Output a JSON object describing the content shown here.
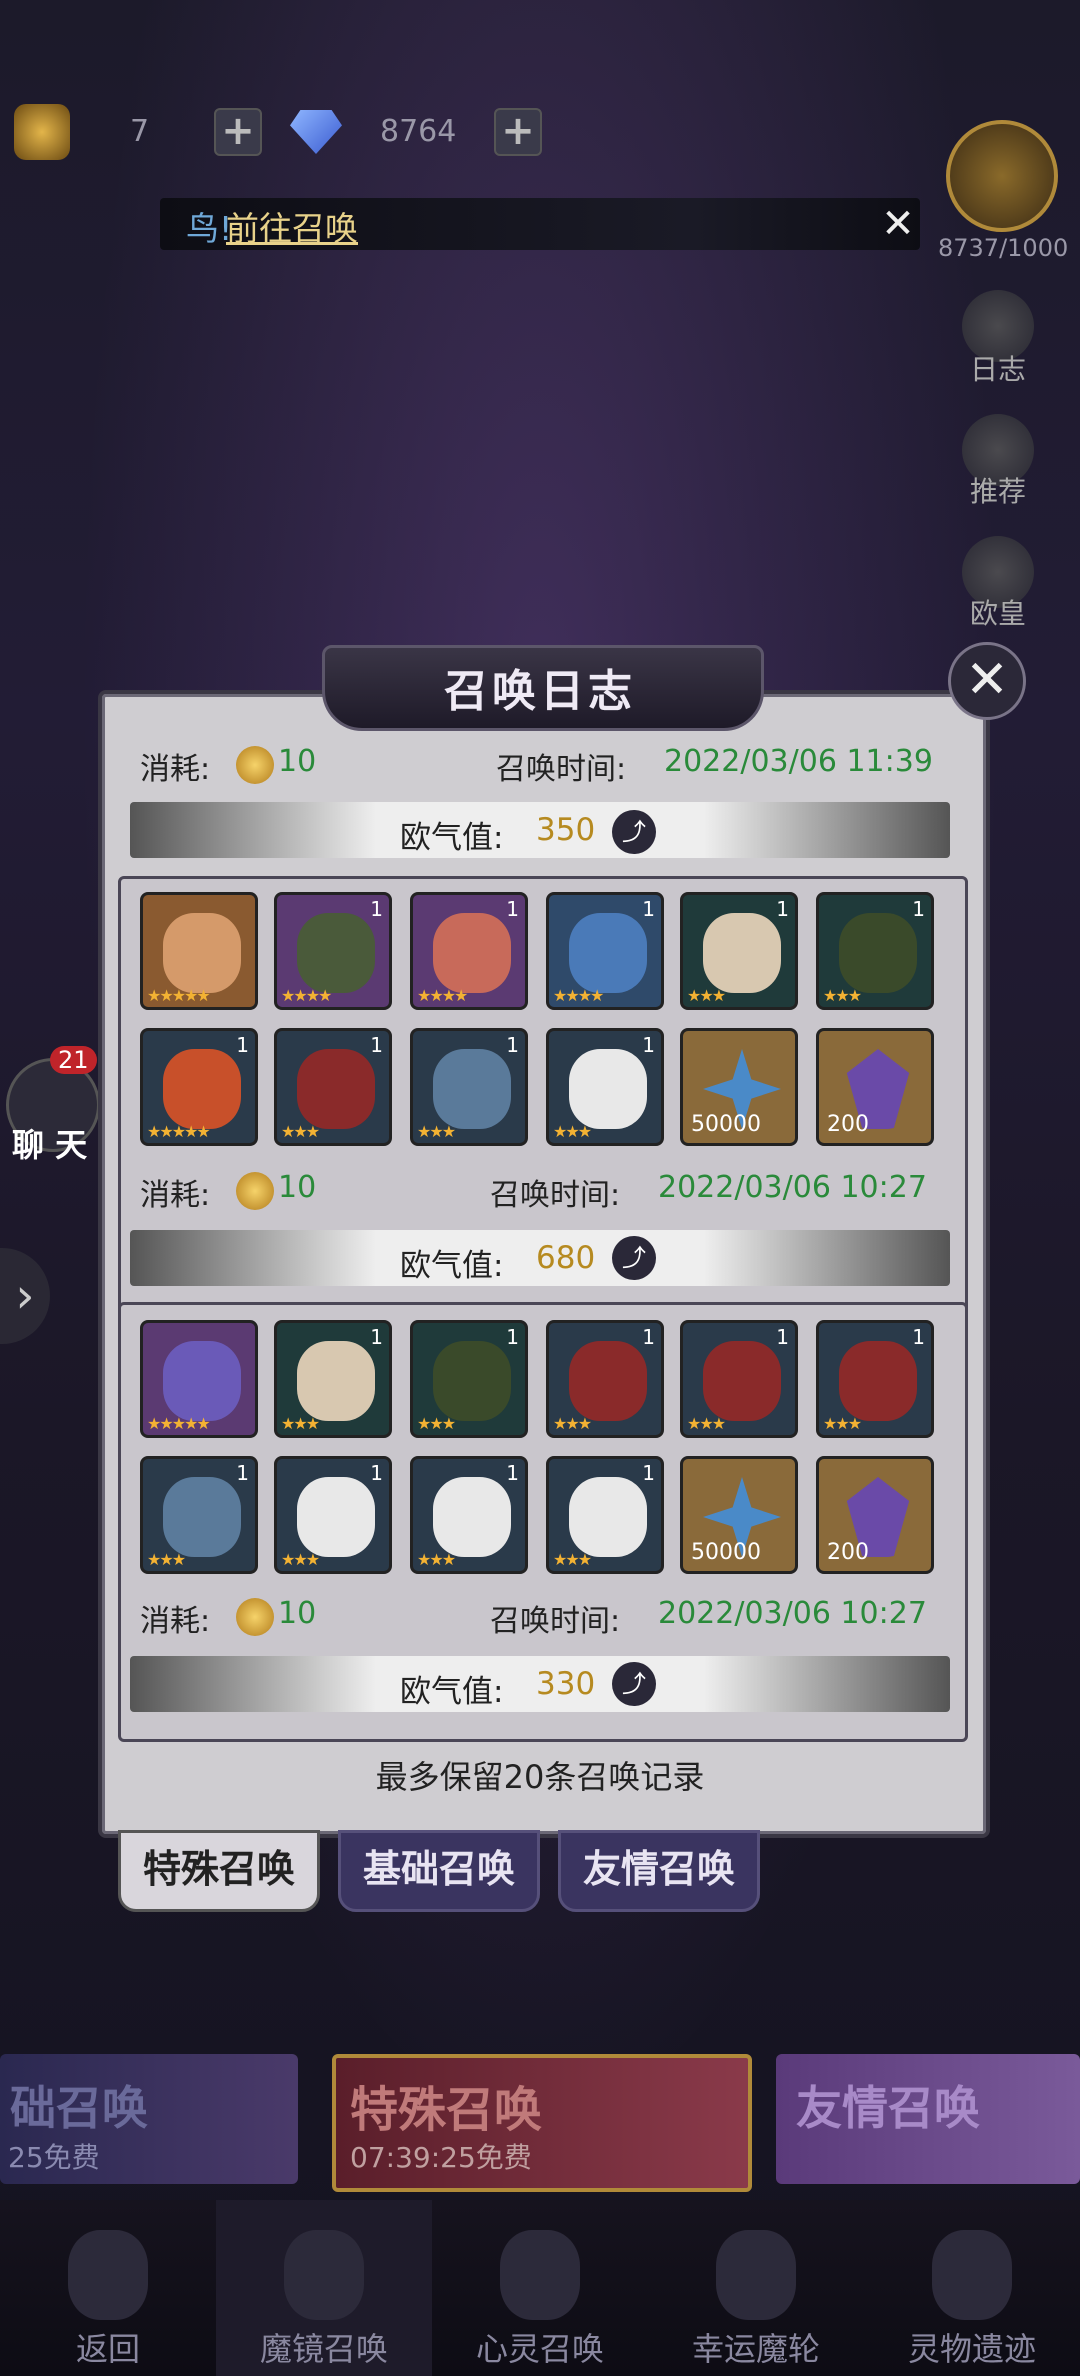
{
  "topbar": {
    "tickets": "7",
    "gems": "8764",
    "avatar_progress": "8737/1000"
  },
  "banner": {
    "prefix": "鸟!",
    "link_text": "前往召唤"
  },
  "side_buttons": [
    "日志",
    "推荐",
    "欧皇"
  ],
  "chat": {
    "badge": "21",
    "label": "聊 天"
  },
  "dialog": {
    "title": "召唤日志",
    "cost_label": "消耗:",
    "time_label": "召唤时间:",
    "lucky_label": "欧气值:",
    "footer_note": "最多保留20条召唤记录",
    "records": [
      {
        "cost": "10",
        "time": "2022/03/06 11:39",
        "lucky": "350"
      },
      {
        "cost": "10",
        "time": "2022/03/06 10:27",
        "lucky": "680"
      },
      {
        "cost": "10",
        "time": "2022/03/06 10:27",
        "lucky": "330"
      }
    ],
    "group1_levels": [
      "",
      "1",
      "1",
      "1",
      "1",
      "1",
      "1",
      "1",
      "1",
      "1",
      "50000",
      "200"
    ],
    "group2_levels": [
      "",
      "1",
      "1",
      "1",
      "1",
      "1",
      "1",
      "1",
      "1",
      "1",
      "50000",
      "200"
    ]
  },
  "tabs": [
    "特殊召唤",
    "基础召唤",
    "友情召唤"
  ],
  "strip": {
    "left_title": "础召唤",
    "left_sub": "25免费",
    "center_title": "特殊召唤",
    "center_sub": "07:39:25免费",
    "right_title": "友情召唤"
  },
  "nav": [
    "返回",
    "魔镜召唤",
    "心灵召唤",
    "幸运魔轮",
    "灵物遗迹"
  ],
  "colors": {
    "accent_gold": "#e8d28a",
    "time_green": "#2a8a3a",
    "tab_active": "#d9d6dc",
    "tab_inactive": "#3a3460"
  }
}
